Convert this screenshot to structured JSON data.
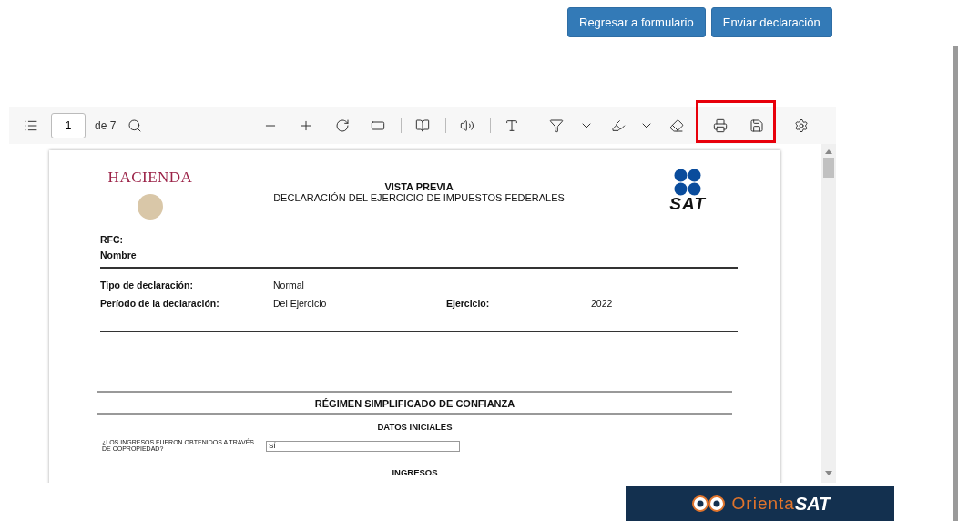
{
  "action_buttons": [
    {
      "label": "Regresar a formulario"
    },
    {
      "label": "Enviar declaración"
    }
  ],
  "viewer": {
    "toolbar": {
      "page_input": "1",
      "page_count": "de 7"
    },
    "document": {
      "hacienda_logo": "HACIENDA",
      "title": "VISTA PREVIA",
      "subtitle": "DECLARACIÓN DEL EJERCICIO DE IMPUESTOS FEDERALES",
      "sat_logo": "SAT",
      "taxpayer_fields": [
        "RFC:",
        "Nombre"
      ],
      "declaration_rows": [
        {
          "label": "Tipo de declaración:",
          "value": "Normal"
        },
        {
          "label": "Período de la declaración:",
          "value": "Del Ejercicio",
          "extra_label": "Ejercicio:",
          "extra_value": "2022"
        }
      ],
      "section_title": "RÉGIMEN SIMPLIFICADO DE CONFIANZA",
      "subsection_title": "DATOS INICIALES",
      "question": {
        "label": "¿LOS INGRESOS FUERON OBTENIDOS A TRAVÉS DE COPROPIEDAD?",
        "answer": "SÍ"
      },
      "next_subsection_title": "INGRESOS"
    }
  },
  "banner": {
    "name": "Orienta",
    "brand": "SAT"
  }
}
